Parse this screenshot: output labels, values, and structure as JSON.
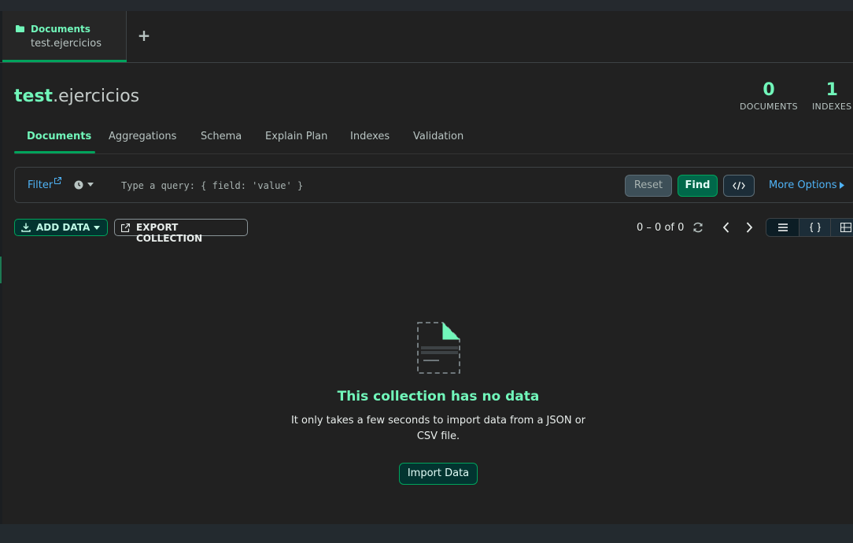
{
  "tab": {
    "title": "Documents",
    "subtitle": "test.ejercicios",
    "add_label": "+"
  },
  "namespace": {
    "db": "test",
    "separator": ".",
    "collection": "ejercicios"
  },
  "stats": {
    "documents": {
      "value": "0",
      "label": "DOCUMENTS"
    },
    "indexes": {
      "value": "1",
      "label": "INDEXES"
    }
  },
  "subtabs": [
    "Documents",
    "Aggregations",
    "Schema",
    "Explain Plan",
    "Indexes",
    "Validation"
  ],
  "query": {
    "filter_label": "Filter",
    "placeholder": "Type a query: { field: 'value' }",
    "reset_label": "Reset",
    "find_label": "Find",
    "code_label": "</>",
    "more_options_label": "More Options"
  },
  "toolbar": {
    "add_data_label": "ADD DATA",
    "export_label": "EXPORT COLLECTION",
    "pagination_text": "0 – 0 of 0",
    "view_modes": [
      "list",
      "json",
      "table"
    ]
  },
  "empty_state": {
    "title": "This collection has no data",
    "description": "It only takes a few seconds to import data from a JSON or CSV file.",
    "import_label": "Import Data"
  },
  "colors": {
    "accent": "#71f6ba",
    "primary": "#00a35c",
    "link": "#4fb3f6",
    "background": "#212121"
  }
}
